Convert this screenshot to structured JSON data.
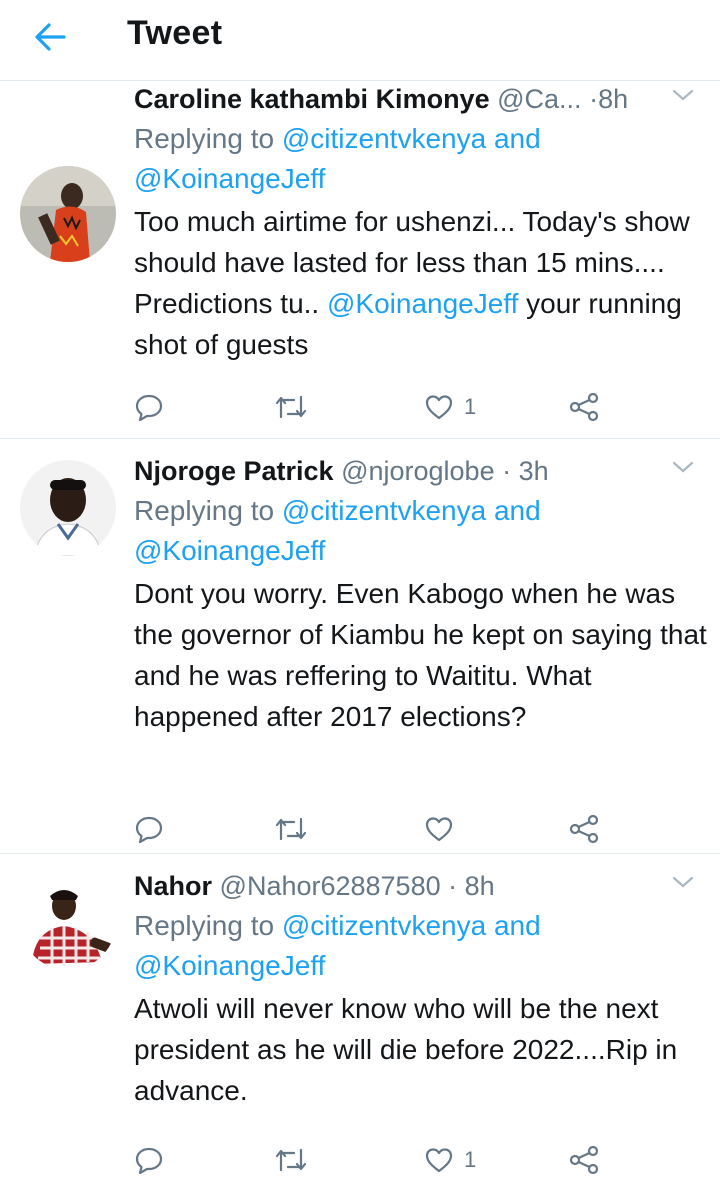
{
  "header": {
    "title": "Tweet"
  },
  "tweets": [
    {
      "name": "Caroline kathambi Kimonye",
      "handle": "@Ca...",
      "dot": "·",
      "time": "8h",
      "replying_prefix": "Replying to",
      "mention1": "@citizentvkenya",
      "and": "and",
      "mention2": "@KoinangeJeff",
      "body_part1": "Too much airtime for ushenzi...  Today's show should have lasted for less than 15 mins.... Predictions tu..",
      "body_mention": "@KoinangeJeff",
      "body_part2": "your running shot of guests",
      "like_count": "1"
    },
    {
      "name": "Njoroge Patrick",
      "handle": "@njoroglobe",
      "dot": "·",
      "time": "3h",
      "replying_prefix": "Replying to",
      "mention1": "@citizentvkenya",
      "and": "and",
      "mention2": "@KoinangeJeff",
      "body": "Dont you worry. Even Kabogo when he was the governor of Kiambu he kept on saying that and he was reffering to Waititu. What happened after 2017 elections?",
      "like_count": ""
    },
    {
      "name": "Nahor",
      "handle": "@Nahor62887580",
      "dot": "·",
      "time": "8h",
      "replying_prefix": "Replying to",
      "mention1": "@citizentvkenya",
      "and": "and",
      "mention2": "@KoinangeJeff",
      "body": "Atwoli will never know who will be the next president as he will die before 2022....Rip in advance.",
      "like_count": "1"
    }
  ],
  "icons": {
    "back": "arrow-left-icon",
    "caret": "chevron-down-icon",
    "reply": "comment-icon",
    "retweet": "retweet-icon",
    "like": "heart-icon",
    "share": "share-icon"
  },
  "colors": {
    "accent": "#1da1f2",
    "secondary": "#657786",
    "text": "#14171a",
    "divider": "#e1e8ed"
  }
}
